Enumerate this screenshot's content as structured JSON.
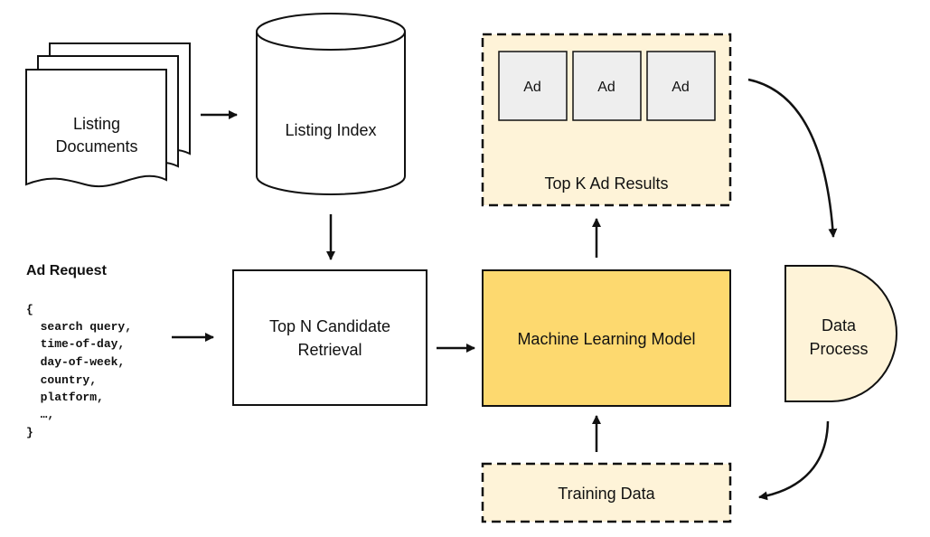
{
  "nodes": {
    "listing_documents": {
      "line1": "Listing",
      "line2": "Documents"
    },
    "listing_index": {
      "label": "Listing Index"
    },
    "ad_request": {
      "title": "Ad Request",
      "code_lines": [
        "{",
        "  search query,",
        "  time-of-day,",
        "  day-of-week,",
        "  country,",
        "  platform,",
        "  …,",
        "}"
      ]
    },
    "top_n": {
      "line1": "Top N Candidate",
      "line2": "Retrieval"
    },
    "ml_model": {
      "label": "Machine Learning Model"
    },
    "top_k": {
      "label": "Top K Ad Results",
      "ads": [
        "Ad",
        "Ad",
        "Ad"
      ]
    },
    "data_process": {
      "line1": "Data",
      "line2": "Process"
    },
    "training_data": {
      "label": "Training Data"
    }
  },
  "colors": {
    "ml_fill": "#fdd96f",
    "light_fill": "#fef3d8",
    "ad_fill": "#eeeeee",
    "stroke": "#111111"
  }
}
